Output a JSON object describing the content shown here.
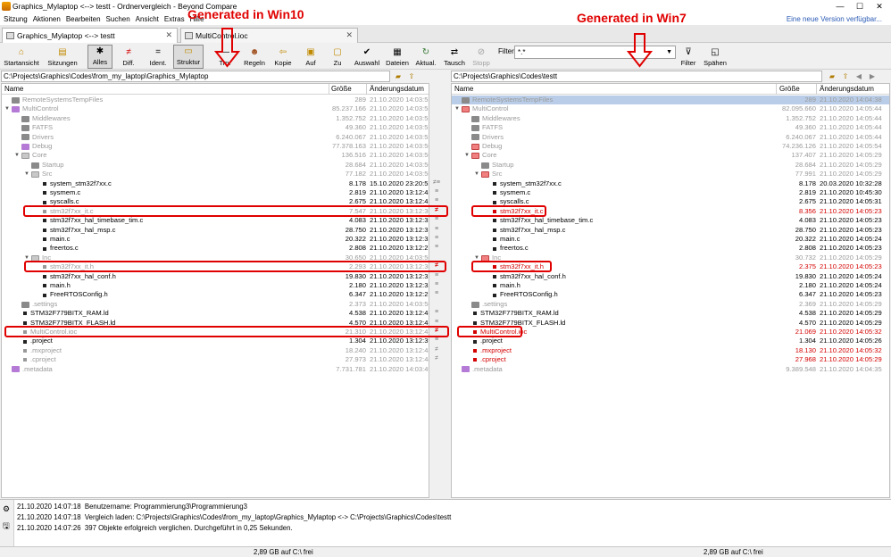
{
  "window": {
    "title": "Graphics_Mylaptop <--> testt - Ordnervergleich - Beyond Compare",
    "minimize": "—",
    "maximize": "☐",
    "close": "✕"
  },
  "menu": {
    "items": [
      "Sitzung",
      "Aktionen",
      "Bearbeiten",
      "Suchen",
      "Ansicht",
      "Extras",
      "Hilfe"
    ],
    "update_notice": "Eine neue Version verfügbar..."
  },
  "tabs": [
    {
      "label": "Graphics_Mylaptop <--> testt",
      "close": "✕"
    },
    {
      "label": "MultiControl.ioc",
      "close": "✕"
    }
  ],
  "toolbar": {
    "buttons": [
      "Startansicht",
      "Sitzungen",
      "Alles",
      "Diff.",
      "Ident.",
      "Struktur",
      "Trn.",
      "Regeln",
      "Kopie",
      "Auf",
      "Zu",
      "Auswahl",
      "Dateien",
      "Aktual.",
      "Tausch",
      "Stopp",
      "Filter",
      "Spähen"
    ],
    "filter_label": "Filter:",
    "filter_value": "*.*"
  },
  "paths": {
    "left": "C:\\Projects\\Graphics\\Codes\\from_my_laptop\\Graphics_Mylaptop",
    "right": "C:\\Projects\\Graphics\\Codes\\testt"
  },
  "columns": {
    "name": "Name",
    "size": "Größe",
    "date": "Änderungsdatum"
  },
  "left_rows": [
    {
      "name": "RemoteSystemsTempFiles",
      "size": "289",
      "date": "21.10.2020 14:03:51",
      "indent": 0,
      "kind": "fg",
      "style": "grey"
    },
    {
      "name": "MultiControl",
      "size": "85.237.166",
      "date": "21.10.2020 14:03:51",
      "indent": 0,
      "kind": "fp",
      "style": "grey",
      "open": true
    },
    {
      "name": "Middlewares",
      "size": "1.352.752",
      "date": "21.10.2020 14:03:51",
      "indent": 1,
      "kind": "fg",
      "style": "grey"
    },
    {
      "name": "FATFS",
      "size": "49.360",
      "date": "21.10.2020 14:03:51",
      "indent": 1,
      "kind": "fg",
      "style": "grey"
    },
    {
      "name": "Drivers",
      "size": "6.240.067",
      "date": "21.10.2020 14:03:51",
      "indent": 1,
      "kind": "fg",
      "style": "grey"
    },
    {
      "name": "Debug",
      "size": "77.378.163",
      "date": "21.10.2020 14:03:50",
      "indent": 1,
      "kind": "fp",
      "style": "grey"
    },
    {
      "name": "Core",
      "size": "136.516",
      "date": "21.10.2020 14:03:50",
      "indent": 1,
      "kind": "fgl",
      "style": "grey",
      "open": true
    },
    {
      "name": "Startup",
      "size": "28.684",
      "date": "21.10.2020 14:03:50",
      "indent": 2,
      "kind": "fg",
      "style": "grey"
    },
    {
      "name": "Src",
      "size": "77.182",
      "date": "21.10.2020 14:03:50",
      "indent": 2,
      "kind": "fgl",
      "style": "grey",
      "open": true
    },
    {
      "name": "system_stm32f7xx.c",
      "size": "8.178",
      "date": "15.10.2020 23:20:57",
      "indent": 3,
      "kind": "b",
      "style": "",
      "mark": "≠≡"
    },
    {
      "name": "sysmem.c",
      "size": "2.819",
      "date": "21.10.2020 13:12:45",
      "indent": 3,
      "kind": "b",
      "style": "",
      "mark": "≡"
    },
    {
      "name": "syscalls.c",
      "size": "2.675",
      "date": "21.10.2020 13:12:45",
      "indent": 3,
      "kind": "b",
      "style": "",
      "mark": "≡"
    },
    {
      "name": "stm32f7xx_it.c",
      "size": "7.547",
      "date": "21.10.2020 13:12:30",
      "indent": 3,
      "kind": "b",
      "style": "grey",
      "mark": "≠",
      "mred": true
    },
    {
      "name": "stm32f7xx_hal_timebase_tim.c",
      "size": "4.083",
      "date": "21.10.2020 13:12:32",
      "indent": 3,
      "kind": "b",
      "style": "",
      "mark": "≡"
    },
    {
      "name": "stm32f7xx_hal_msp.c",
      "size": "28.750",
      "date": "21.10.2020 13:12:31",
      "indent": 3,
      "kind": "b",
      "style": "",
      "mark": "≡"
    },
    {
      "name": "main.c",
      "size": "20.322",
      "date": "21.10.2020 13:12:32",
      "indent": 3,
      "kind": "b",
      "style": "",
      "mark": "≡"
    },
    {
      "name": "freertos.c",
      "size": "2.808",
      "date": "21.10.2020 13:12:27",
      "indent": 3,
      "kind": "b",
      "style": "",
      "mark": "≡"
    },
    {
      "name": "Inc",
      "size": "30.650",
      "date": "21.10.2020 14:03:50",
      "indent": 2,
      "kind": "fgl",
      "style": "grey",
      "open": true
    },
    {
      "name": "stm32f7xx_it.h",
      "size": "2.293",
      "date": "21.10.2020 13:12:30",
      "indent": 3,
      "kind": "b",
      "style": "grey",
      "mark": "≠",
      "mred": true
    },
    {
      "name": "stm32f7xx_hal_conf.h",
      "size": "19.830",
      "date": "21.10.2020 13:12:32",
      "indent": 3,
      "kind": "b",
      "style": "",
      "mark": "≡"
    },
    {
      "name": "main.h",
      "size": "2.180",
      "date": "21.10.2020 13:12:32",
      "indent": 3,
      "kind": "b",
      "style": "",
      "mark": "≡"
    },
    {
      "name": "FreeRTOSConfig.h",
      "size": "6.347",
      "date": "21.10.2020 13:12:29",
      "indent": 3,
      "kind": "b",
      "style": "",
      "mark": "≡"
    },
    {
      "name": ".settings",
      "size": "2.373",
      "date": "21.10.2020 14:03:50",
      "indent": 1,
      "kind": "fg",
      "style": "grey"
    },
    {
      "name": "STM32F779BITX_RAM.ld",
      "size": "4.538",
      "date": "21.10.2020 13:12:45",
      "indent": 1,
      "kind": "b",
      "style": "",
      "mark": "≡"
    },
    {
      "name": "STM32F779BITX_FLASH.ld",
      "size": "4.570",
      "date": "21.10.2020 13:12:45",
      "indent": 1,
      "kind": "b",
      "style": "",
      "mark": "≡"
    },
    {
      "name": "MultiControl.ioc",
      "size": "21.310",
      "date": "21.10.2020 13:12:45",
      "indent": 1,
      "kind": "b",
      "style": "grey",
      "mark": "≠",
      "mred": true
    },
    {
      "name": ".project",
      "size": "1.304",
      "date": "21.10.2020 13:12:39",
      "indent": 1,
      "kind": "b",
      "style": "",
      "mark": "≡"
    },
    {
      "name": ".mxproject",
      "size": "18.240",
      "date": "21.10.2020 13:12:45",
      "indent": 1,
      "kind": "b",
      "style": "grey",
      "mark": "≠"
    },
    {
      "name": ".cproject",
      "size": "27.973",
      "date": "21.10.2020 13:12:44",
      "indent": 1,
      "kind": "b",
      "style": "grey",
      "mark": "≠"
    },
    {
      "name": ".metadata",
      "size": "7.731.781",
      "date": "21.10.2020 14:03:49",
      "indent": 0,
      "kind": "fp",
      "style": "grey"
    }
  ],
  "right_rows": [
    {
      "name": "RemoteSystemsTempFiles",
      "size": "289",
      "date": "21.10.2020 14:04:38",
      "indent": 0,
      "kind": "fg",
      "style": "sel"
    },
    {
      "name": "MultiControl",
      "size": "82.095.660",
      "date": "21.10.2020 14:05:44",
      "indent": 0,
      "kind": "fr",
      "style": "grey",
      "open": true
    },
    {
      "name": "Middlewares",
      "size": "1.352.752",
      "date": "21.10.2020 14:05:44",
      "indent": 1,
      "kind": "fg",
      "style": "grey"
    },
    {
      "name": "FATFS",
      "size": "49.360",
      "date": "21.10.2020 14:05:44",
      "indent": 1,
      "kind": "fg",
      "style": "grey"
    },
    {
      "name": "Drivers",
      "size": "6.240.067",
      "date": "21.10.2020 14:05:44",
      "indent": 1,
      "kind": "fg",
      "style": "grey"
    },
    {
      "name": "Debug",
      "size": "74.236.126",
      "date": "21.10.2020 14:05:54",
      "indent": 1,
      "kind": "fr",
      "style": "grey"
    },
    {
      "name": "Core",
      "size": "137.407",
      "date": "21.10.2020 14:05:29",
      "indent": 1,
      "kind": "fr",
      "style": "grey",
      "open": true
    },
    {
      "name": "Startup",
      "size": "28.684",
      "date": "21.10.2020 14:05:29",
      "indent": 2,
      "kind": "fg",
      "style": "grey"
    },
    {
      "name": "Src",
      "size": "77.991",
      "date": "21.10.2020 14:05:29",
      "indent": 2,
      "kind": "fr",
      "style": "grey",
      "open": true
    },
    {
      "name": "system_stm32f7xx.c",
      "size": "8.178",
      "date": "20.03.2020 10:32:28",
      "indent": 3,
      "kind": "b",
      "style": ""
    },
    {
      "name": "sysmem.c",
      "size": "2.819",
      "date": "21.10.2020 10:45:30",
      "indent": 3,
      "kind": "b",
      "style": ""
    },
    {
      "name": "syscalls.c",
      "size": "2.675",
      "date": "21.10.2020 14:05:31",
      "indent": 3,
      "kind": "b",
      "style": ""
    },
    {
      "name": "stm32f7xx_it.c",
      "size": "8.356",
      "date": "21.10.2020 14:05:23",
      "indent": 3,
      "kind": "b",
      "style": "red"
    },
    {
      "name": "stm32f7xx_hal_timebase_tim.c",
      "size": "4.083",
      "date": "21.10.2020 14:05:23",
      "indent": 3,
      "kind": "b",
      "style": ""
    },
    {
      "name": "stm32f7xx_hal_msp.c",
      "size": "28.750",
      "date": "21.10.2020 14:05:23",
      "indent": 3,
      "kind": "b",
      "style": ""
    },
    {
      "name": "main.c",
      "size": "20.322",
      "date": "21.10.2020 14:05:24",
      "indent": 3,
      "kind": "b",
      "style": ""
    },
    {
      "name": "freertos.c",
      "size": "2.808",
      "date": "21.10.2020 14:05:23",
      "indent": 3,
      "kind": "b",
      "style": ""
    },
    {
      "name": "Inc",
      "size": "30.732",
      "date": "21.10.2020 14:05:29",
      "indent": 2,
      "kind": "fr",
      "style": "grey",
      "open": true
    },
    {
      "name": "stm32f7xx_it.h",
      "size": "2.375",
      "date": "21.10.2020 14:05:23",
      "indent": 3,
      "kind": "b",
      "style": "red"
    },
    {
      "name": "stm32f7xx_hal_conf.h",
      "size": "19.830",
      "date": "21.10.2020 14:05:24",
      "indent": 3,
      "kind": "b",
      "style": ""
    },
    {
      "name": "main.h",
      "size": "2.180",
      "date": "21.10.2020 14:05:24",
      "indent": 3,
      "kind": "b",
      "style": ""
    },
    {
      "name": "FreeRTOSConfig.h",
      "size": "6.347",
      "date": "21.10.2020 14:05:23",
      "indent": 3,
      "kind": "b",
      "style": ""
    },
    {
      "name": ".settings",
      "size": "2.369",
      "date": "21.10.2020 14:05:29",
      "indent": 1,
      "kind": "fg",
      "style": "grey"
    },
    {
      "name": "STM32F779BITX_RAM.ld",
      "size": "4.538",
      "date": "21.10.2020 14:05:29",
      "indent": 1,
      "kind": "b",
      "style": ""
    },
    {
      "name": "STM32F779BITX_FLASH.ld",
      "size": "4.570",
      "date": "21.10.2020 14:05:29",
      "indent": 1,
      "kind": "b",
      "style": ""
    },
    {
      "name": "MultiControl.ioc",
      "size": "21.069",
      "date": "21.10.2020 14:05:32",
      "indent": 1,
      "kind": "b",
      "style": "red"
    },
    {
      "name": ".project",
      "size": "1.304",
      "date": "21.10.2020 14:05:26",
      "indent": 1,
      "kind": "b",
      "style": ""
    },
    {
      "name": ".mxproject",
      "size": "18.130",
      "date": "21.10.2020 14:05:32",
      "indent": 1,
      "kind": "b",
      "style": "red"
    },
    {
      "name": ".cproject",
      "size": "27.968",
      "date": "21.10.2020 14:05:29",
      "indent": 1,
      "kind": "b",
      "style": "red"
    },
    {
      "name": ".metadata",
      "size": "9.389.548",
      "date": "21.10.2020 14:04:35",
      "indent": 0,
      "kind": "fp",
      "style": "grey"
    }
  ],
  "log": [
    {
      "time": "21.10.2020 14:07:18",
      "text": "Benutzername: Programmierung3\\Programmierung3"
    },
    {
      "time": "21.10.2020 14:07:18",
      "text": "Vergleich laden: C:\\Projects\\Graphics\\Codes\\from_my_laptop\\Graphics_Mylaptop <-> C:\\Projects\\Graphics\\Codes\\testt"
    },
    {
      "time": "21.10.2020 14:07:26",
      "text": "397 Objekte erfolgreich verglichen.  Durchgeführt in 0,25 Sekunden."
    }
  ],
  "status": {
    "left": "2,89 GB auf C:\\ frei",
    "right": "2,89 GB auf C:\\ frei"
  },
  "annotations": {
    "left": "Generated in Win10",
    "right": "Generated in Win7"
  },
  "colors": {
    "annotation": "#e00000",
    "diff_red": "#d40000",
    "selected_row": "#b9cde8"
  }
}
